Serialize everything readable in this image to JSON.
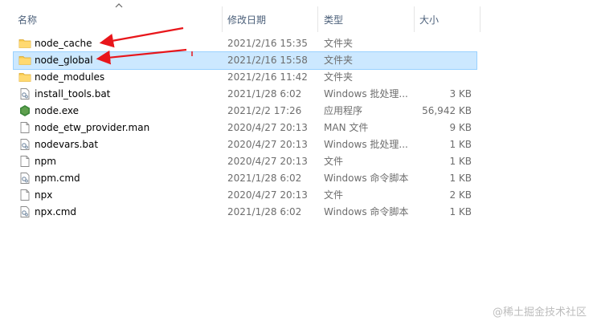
{
  "columns": {
    "name": "名称",
    "date": "修改日期",
    "type": "类型",
    "size": "大小"
  },
  "files": [
    {
      "name": "node_cache",
      "date": "2021/2/16 15:35",
      "type": "文件夹",
      "size": "",
      "icon": "folder-icon",
      "selected": false
    },
    {
      "name": "node_global",
      "date": "2021/2/16 15:58",
      "type": "文件夹",
      "size": "",
      "icon": "folder-icon",
      "selected": true
    },
    {
      "name": "node_modules",
      "date": "2021/2/16 11:42",
      "type": "文件夹",
      "size": "",
      "icon": "folder-icon",
      "selected": false
    },
    {
      "name": "install_tools.bat",
      "date": "2021/1/28 6:02",
      "type": "Windows 批处理...",
      "size": "3 KB",
      "icon": "batch-file-icon",
      "selected": false
    },
    {
      "name": "node.exe",
      "date": "2021/2/2 17:26",
      "type": "应用程序",
      "size": "56,942 KB",
      "icon": "nodejs-icon",
      "selected": false
    },
    {
      "name": "node_etw_provider.man",
      "date": "2020/4/27 20:13",
      "type": "MAN 文件",
      "size": "9 KB",
      "icon": "file-icon",
      "selected": false
    },
    {
      "name": "nodevars.bat",
      "date": "2020/4/27 20:13",
      "type": "Windows 批处理...",
      "size": "1 KB",
      "icon": "batch-file-icon",
      "selected": false
    },
    {
      "name": "npm",
      "date": "2020/4/27 20:13",
      "type": "文件",
      "size": "1 KB",
      "icon": "file-icon",
      "selected": false
    },
    {
      "name": "npm.cmd",
      "date": "2021/1/28 6:02",
      "type": "Windows 命令脚本",
      "size": "1 KB",
      "icon": "cmd-file-icon",
      "selected": false
    },
    {
      "name": "npx",
      "date": "2020/4/27 20:13",
      "type": "文件",
      "size": "2 KB",
      "icon": "file-icon",
      "selected": false
    },
    {
      "name": "npx.cmd",
      "date": "2021/1/28 6:02",
      "type": "Windows 命令脚本",
      "size": "1 KB",
      "icon": "cmd-file-icon",
      "selected": false
    }
  ],
  "watermark": "@稀土掘金技术社区",
  "colors": {
    "selected_bg": "#cce8ff",
    "annotation_arrow": "#e8161b",
    "folder": "#f7c94b"
  }
}
